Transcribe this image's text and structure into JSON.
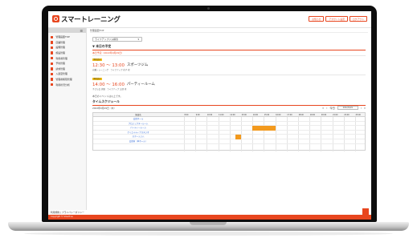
{
  "app": {
    "logo_text": "スマートレーニング",
    "brand_color": "#e8461f",
    "header_buttons": [
      {
        "label": "お知らせ",
        "icon": "bell-icon"
      },
      {
        "label": "アカウント設定",
        "icon": "user-icon"
      },
      {
        "label": "ログアウト",
        "icon": "logout-icon"
      }
    ]
  },
  "sidebar": {
    "toggle_icon": "☰",
    "items": [
      {
        "label": "管理画面TOP",
        "icon": "home-icon"
      },
      {
        "label": "店舗管理",
        "icon": "store-icon"
      },
      {
        "label": "設備管理",
        "icon": "equipment-icon"
      },
      {
        "label": "施設管理",
        "icon": "facility-icon"
      },
      {
        "label": "利用者管理",
        "icon": "users-icon"
      },
      {
        "label": "予約管理",
        "icon": "calendar-icon"
      },
      {
        "label": "請求管理",
        "icon": "invoice-icon"
      },
      {
        "label": "入退室管理",
        "icon": "door-icon"
      },
      {
        "label": "管理者権限管理",
        "icon": "lock-icon"
      },
      {
        "label": "利用状況分析",
        "icon": "chart-icon"
      }
    ]
  },
  "main": {
    "breadcrumb": "管理画面TOP",
    "facility_select": "ライフアップジム横浜",
    "today_section_title": "▼ 本日の予定",
    "today_date": "本日予定（2022年9月29日）",
    "events": [
      {
        "badge": "予約済み",
        "time": "12:30 〜 13:00",
        "name": "スポーツジム",
        "detail": "自重トレーニング　ライフアップ 花子 様"
      },
      {
        "badge": "予約済み",
        "time": "14:00 〜 16:00",
        "name": "パーティールーム",
        "detail": "子ども会 詳細　ライフアップ 太郎 様"
      }
    ],
    "no_more_events": "本日のイベントは以上です。",
    "schedule_title": "タイムスケジュール",
    "schedule_date": "2022年9月29日（木）",
    "nav": {
      "first": "«",
      "prev": "‹",
      "today": "今日",
      "date": "2022/9/29",
      "next": "›",
      "last": "»"
    },
    "grid_header": "施設名",
    "time_ticks": [
      "8:00",
      "9:00",
      "10:00",
      "11:00",
      "12:00",
      "13:00",
      "14:00",
      "15:00",
      "16:00",
      "17:00",
      "18:00",
      "19:00",
      "20:00",
      "21:00",
      "22:00",
      "23:00"
    ],
    "facilities": [
      "会議ホール",
      "プロジェクタールーム",
      "パーティールーム",
      "クリエイティブスタジオ",
      "スポーツジム",
      "会議室（中ホール）"
    ],
    "bookings": [
      {
        "facility": 2,
        "start": 14.0,
        "end": 16.0
      },
      {
        "facility": 4,
        "start": 12.5,
        "end": 13.0
      }
    ]
  },
  "footer": {
    "links": "利用規約 | プライバシーポリシー",
    "copyright": "Copyright © Smart Le.",
    "to_top_icon": "arrow-up-icon"
  }
}
